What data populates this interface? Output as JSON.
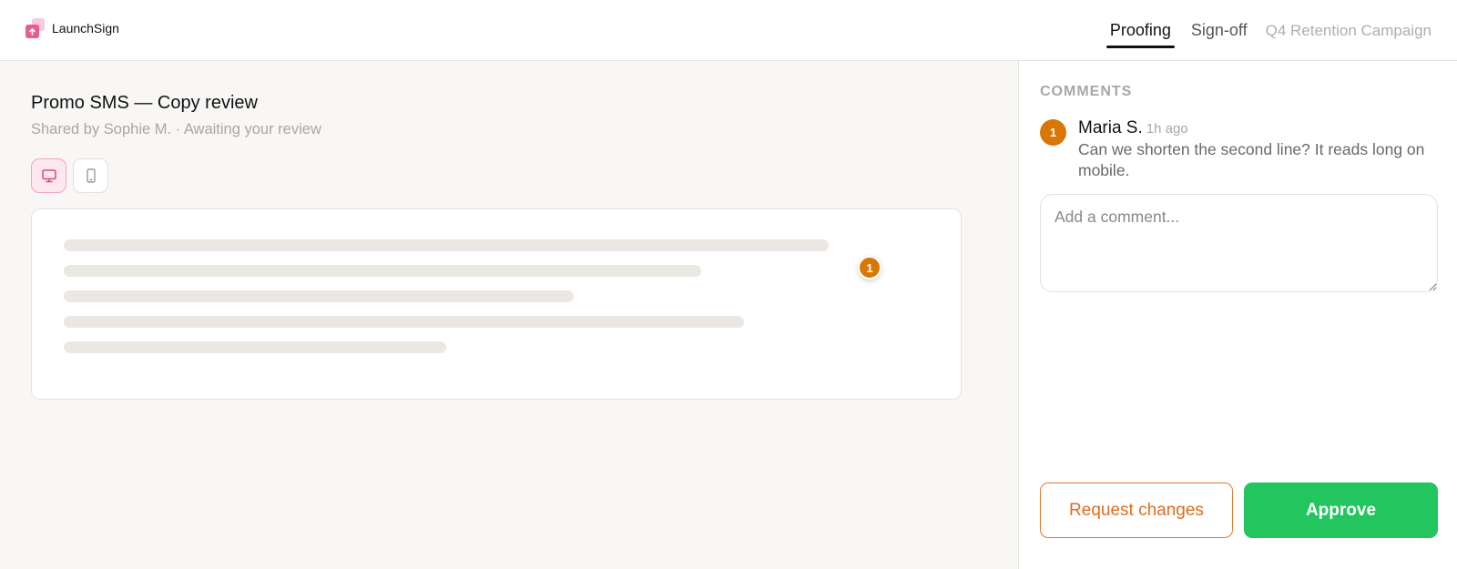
{
  "app": {
    "name": "LaunchSign"
  },
  "nav": {
    "tabs": [
      {
        "label": "Proofing",
        "active": true
      },
      {
        "label": "Sign-off",
        "active": false
      }
    ],
    "campaign": "Q4 Retention Campaign"
  },
  "document": {
    "title": "Promo SMS — Copy review",
    "subtitle": "Shared by Sophie M. · Awaiting your review",
    "preview_mode": "desktop",
    "pin_label": "1"
  },
  "comments": {
    "heading": "COMMENTS",
    "items": [
      {
        "badge": "1",
        "author": "Maria S.",
        "time": "1h ago",
        "text": "Can we shorten the second line? It reads long on mobile."
      }
    ],
    "input_placeholder": "Add a comment..."
  },
  "actions": {
    "request_changes": "Request changes",
    "approve": "Approve"
  },
  "colors": {
    "accent": "#e85b93",
    "approve": "#22c55e",
    "request": "#e06c1c",
    "pin": "#d97706"
  }
}
